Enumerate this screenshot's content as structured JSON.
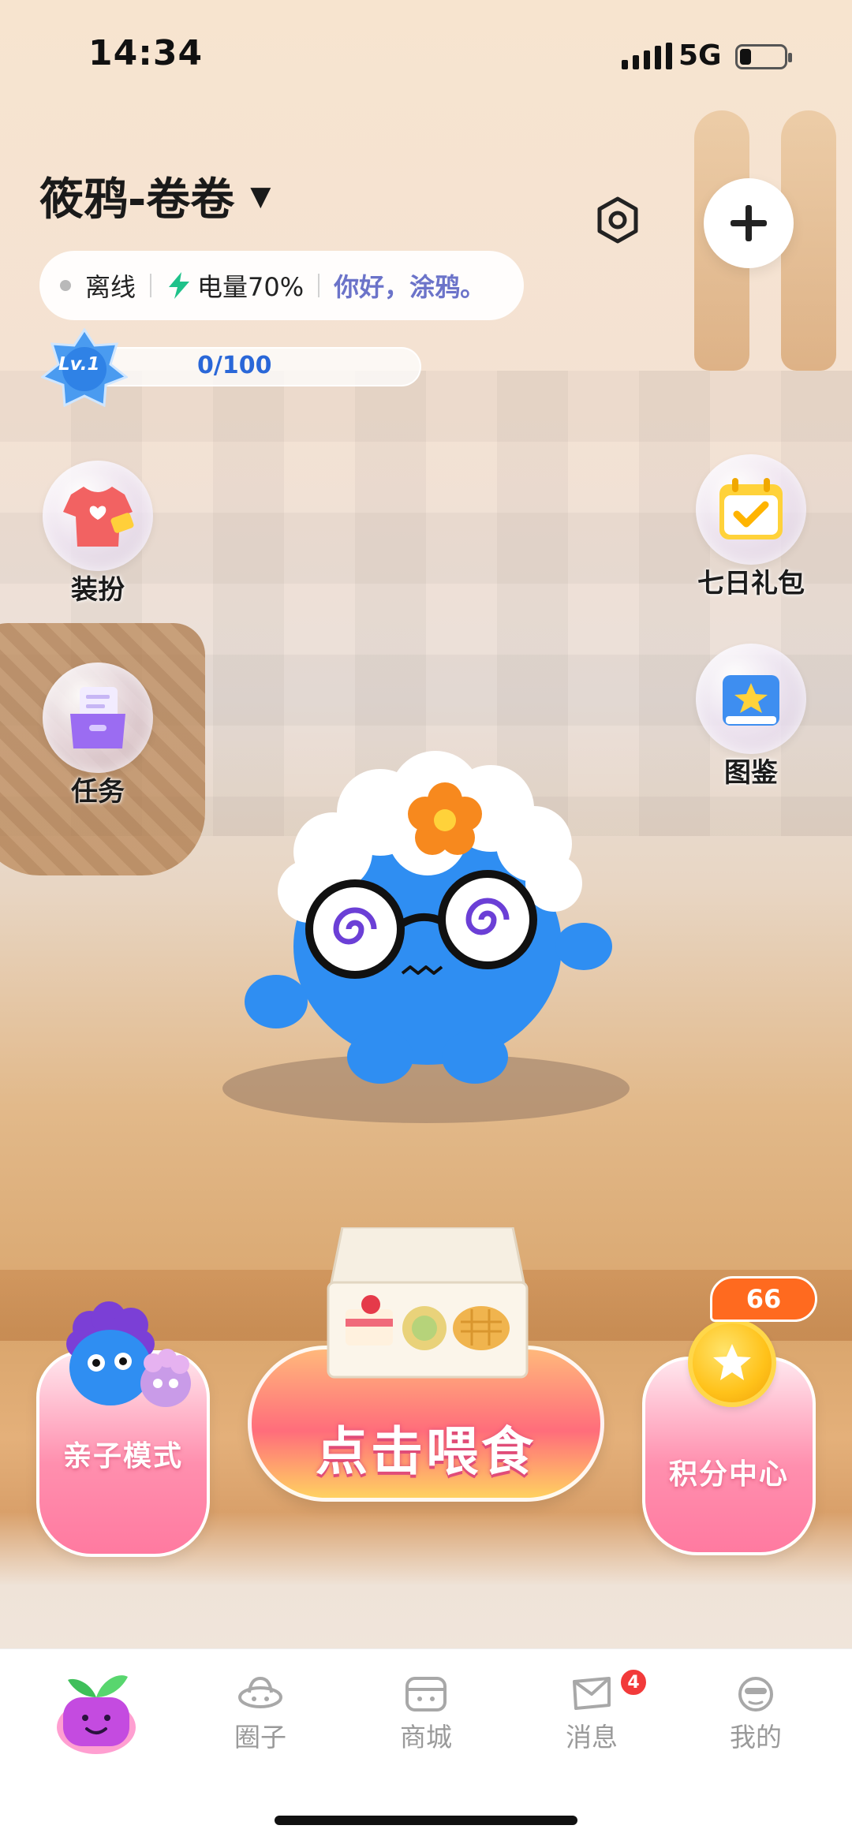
{
  "status_bar": {
    "time": "14:34",
    "network": "5G"
  },
  "header": {
    "pet_name": "筱鸦-卷卷",
    "caret": "▼"
  },
  "status": {
    "online": "离线",
    "battery": "电量70%",
    "greeting": "你好，涂鸦。"
  },
  "level": {
    "badge": "Lv.1",
    "progress_text": "0/100",
    "progress_fraction": 0.0
  },
  "side_left": [
    {
      "label": "装扮",
      "icon": "tshirt-icon"
    },
    {
      "label": "任务",
      "icon": "task-box-icon"
    }
  ],
  "side_right": [
    {
      "label": "七日礼包",
      "icon": "calendar-check-icon"
    },
    {
      "label": "图鉴",
      "icon": "book-star-icon"
    }
  ],
  "actions": {
    "parent_child": "亲子模式",
    "feed": "点击喂食",
    "points_center": "积分中心",
    "points": "66"
  },
  "tabs": [
    {
      "label": "",
      "icon": "plant-pot-icon",
      "active": true
    },
    {
      "label": "圈子",
      "icon": "ufo-icon"
    },
    {
      "label": "商城",
      "icon": "shop-icon"
    },
    {
      "label": "消息",
      "icon": "message-icon",
      "badge": "4"
    },
    {
      "label": "我的",
      "icon": "profile-face-icon"
    }
  ],
  "colors": {
    "accent_blue": "#2a67d8",
    "feed_pink": "#ff6d7b",
    "points_orange": "#ff6a1f",
    "badge_red": "#f23a3a"
  }
}
